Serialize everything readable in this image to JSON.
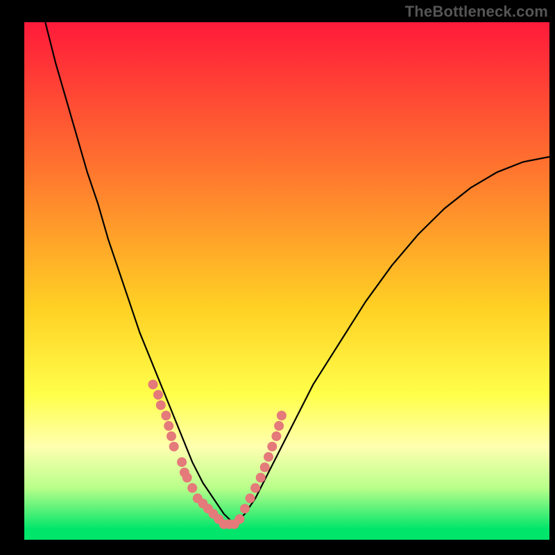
{
  "watermark": "TheBottleneck.com",
  "colors": {
    "frame": "#000000",
    "gradient_top": "#ff1a3a",
    "gradient_mid1": "#ff7a2e",
    "gradient_mid2": "#ffd024",
    "gradient_mid3": "#ffff4a",
    "gradient_band": "#ffffb0",
    "gradient_green": "#00e56a",
    "curve": "#000000",
    "dots": "#e47a7a",
    "watermark_text": "#555555"
  },
  "chart_data": {
    "type": "line",
    "title": "",
    "xlabel": "",
    "ylabel": "",
    "xlim": [
      0,
      100
    ],
    "ylim": [
      0,
      100
    ],
    "series": [
      {
        "name": "bottleneck-curve",
        "x": [
          4,
          6,
          8,
          10,
          12,
          14,
          16,
          18,
          20,
          22,
          24,
          26,
          28,
          30,
          32,
          34,
          36,
          38,
          40,
          42,
          44,
          46,
          48,
          50,
          55,
          60,
          65,
          70,
          75,
          80,
          85,
          90,
          95,
          100
        ],
        "y": [
          100,
          92,
          85,
          78,
          71,
          65,
          58,
          52,
          46,
          40,
          35,
          30,
          25,
          20,
          15,
          11,
          8,
          5,
          3,
          5,
          8,
          12,
          16,
          20,
          30,
          38,
          46,
          53,
          59,
          64,
          68,
          71,
          73,
          74
        ]
      }
    ],
    "dots": {
      "name": "sample-points",
      "x": [
        24.5,
        25.5,
        26,
        27,
        27.5,
        28,
        28.5,
        30,
        30.5,
        31,
        32,
        33,
        34,
        35,
        36,
        37,
        38,
        39,
        40,
        41,
        42,
        43,
        44,
        45,
        45.8,
        46.5,
        47.2,
        48,
        48.5,
        49
      ],
      "y": [
        30,
        28,
        26,
        24,
        22,
        20,
        18,
        15,
        13,
        12,
        10,
        8,
        7,
        6,
        5,
        4,
        3,
        3,
        3,
        4,
        6,
        8,
        10,
        12,
        14,
        16,
        18,
        20,
        22,
        24
      ]
    },
    "background_gradient": {
      "type": "vertical",
      "stops": [
        {
          "offset": 0.0,
          "color": "#ff1a3a"
        },
        {
          "offset": 0.3,
          "color": "#ff7a2e"
        },
        {
          "offset": 0.55,
          "color": "#ffd024"
        },
        {
          "offset": 0.72,
          "color": "#ffff4a"
        },
        {
          "offset": 0.82,
          "color": "#ffffb0"
        },
        {
          "offset": 0.9,
          "color": "#b8ff8a"
        },
        {
          "offset": 0.98,
          "color": "#00e56a"
        }
      ]
    }
  }
}
